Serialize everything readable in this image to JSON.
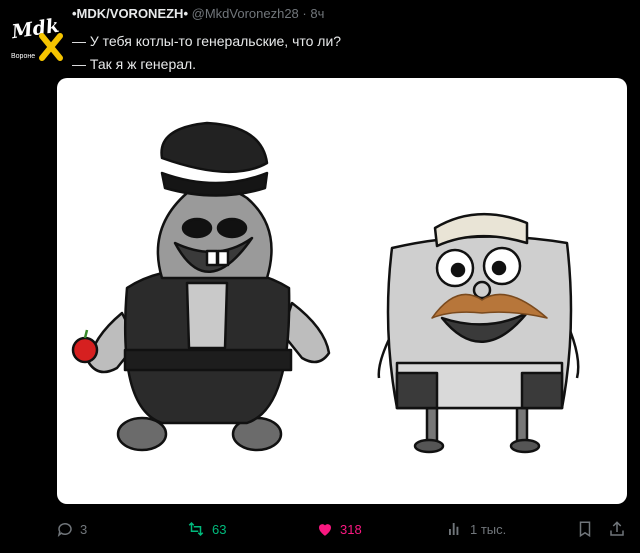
{
  "author": {
    "name": "•MDK/VORONEZH•",
    "handle": "@MkdVoronezh28",
    "separator": "·",
    "time": "8ч",
    "avatar_logo": "Mdk",
    "avatar_sub": "Вороне"
  },
  "post": {
    "line1": "— У тебя котлы-то генеральские, что ли?",
    "line2": "— Так я ж генерал."
  },
  "actions": {
    "replies": "3",
    "reposts": "63",
    "likes": "318",
    "views": "1 тыс."
  },
  "colors": {
    "background": "#000000",
    "text": "#e7e9ea",
    "muted": "#71767b",
    "repost": "#00ba7c",
    "like": "#f91880",
    "logo_accent": "#f5c400"
  },
  "icons": [
    "reply-icon",
    "repost-icon",
    "like-icon",
    "views-icon",
    "bookmark-icon",
    "share-icon"
  ]
}
